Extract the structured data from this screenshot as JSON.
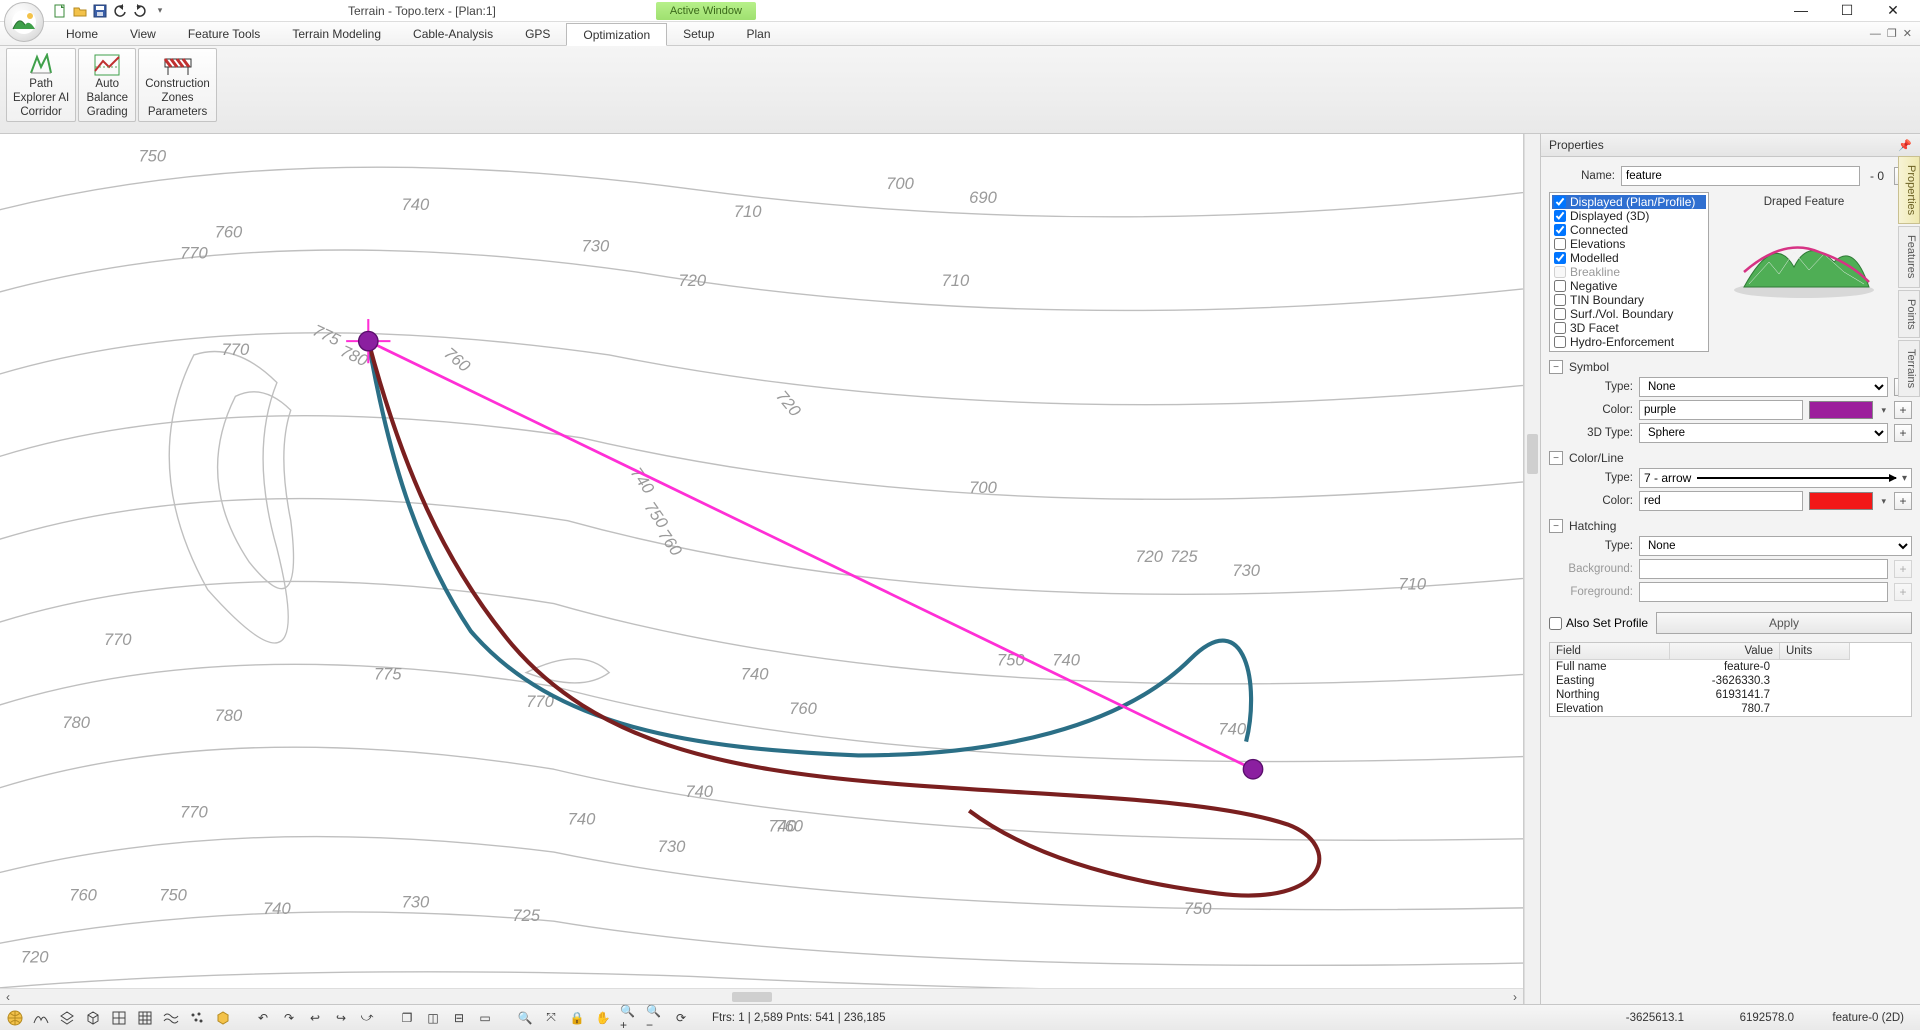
{
  "title": "Terrain - Topo.terx - [Plan:1]",
  "active_window": "Active Window",
  "menu": [
    "Home",
    "View",
    "Feature Tools",
    "Terrain Modeling",
    "Cable-Analysis",
    "GPS",
    "Optimization",
    "Setup",
    "Plan"
  ],
  "menu_active": "Optimization",
  "ribbon": {
    "groups": [
      {
        "id": "path-explorer",
        "label": "Path\nExplorer AI\nCorridor"
      },
      {
        "id": "auto-balance",
        "label": "Auto\nBalance\nGrading"
      },
      {
        "id": "construction-zones",
        "label": "Construction\nZones\nParameters"
      }
    ]
  },
  "properties": {
    "title": "Properties",
    "name_label": "Name:",
    "name_value": "feature",
    "name_suffix": "- 0",
    "preview_title": "Draped Feature",
    "flags": [
      {
        "label": "Displayed (Plan/Profile)",
        "checked": true,
        "selected": true
      },
      {
        "label": "Displayed (3D)",
        "checked": true
      },
      {
        "label": "Connected",
        "checked": true
      },
      {
        "label": "Elevations",
        "checked": false
      },
      {
        "label": "Modelled",
        "checked": true
      },
      {
        "label": "Breakline",
        "checked": false,
        "disabled": true
      },
      {
        "label": "Negative",
        "checked": false
      },
      {
        "label": "TIN Boundary",
        "checked": false
      },
      {
        "label": "Surf./Vol. Boundary",
        "checked": false
      },
      {
        "label": "3D Facet",
        "checked": false
      },
      {
        "label": "Hydro-Enforcement",
        "checked": false
      }
    ],
    "symbol": {
      "title": "Symbol",
      "type_label": "Type:",
      "type_value": "None",
      "color_label": "Color:",
      "color_name": "purple",
      "type3d_label": "3D Type:",
      "type3d_value": "Sphere"
    },
    "colorline": {
      "title": "Color/Line",
      "type_label": "Type:",
      "type_value": "7 - arrow",
      "color_label": "Color:",
      "color_name": "red"
    },
    "hatching": {
      "title": "Hatching",
      "type_label": "Type:",
      "type_value": "None",
      "bg_label": "Background:",
      "fg_label": "Foreground:"
    },
    "also_set_profile": "Also Set Profile",
    "apply": "Apply",
    "grid_headers": [
      "Field",
      "Value",
      "Units"
    ],
    "grid_rows": [
      {
        "field": "Full name",
        "value": "feature-0",
        "units": ""
      },
      {
        "field": "Easting",
        "value": "-3626330.3",
        "units": ""
      },
      {
        "field": "Northing",
        "value": "6193141.7",
        "units": ""
      },
      {
        "field": "Elevation",
        "value": "780.7",
        "units": ""
      }
    ]
  },
  "side_tabs": [
    "Properties",
    "Features",
    "Points",
    "Terrains"
  ],
  "status": {
    "ftrs": "Ftrs: 1 | 2,589  Pnts: 541 | 236,185",
    "coord_x": "-3625613.1",
    "coord_y": "6192578.0",
    "feature": "feature-0 (2D)"
  },
  "contour_labels": [
    "750",
    "740",
    "770",
    "760",
    "775",
    "780",
    "710",
    "720",
    "730",
    "700",
    "690",
    "720",
    "725",
    "730",
    "710",
    "700",
    "740",
    "750",
    "760",
    "740",
    "760",
    "770",
    "775",
    "780",
    "780",
    "770",
    "760",
    "750",
    "740",
    "730",
    "725",
    "740",
    "730",
    "740",
    "740",
    "750",
    "740",
    "760",
    "750",
    "770",
    "780",
    "750",
    "710",
    "770",
    "760"
  ]
}
